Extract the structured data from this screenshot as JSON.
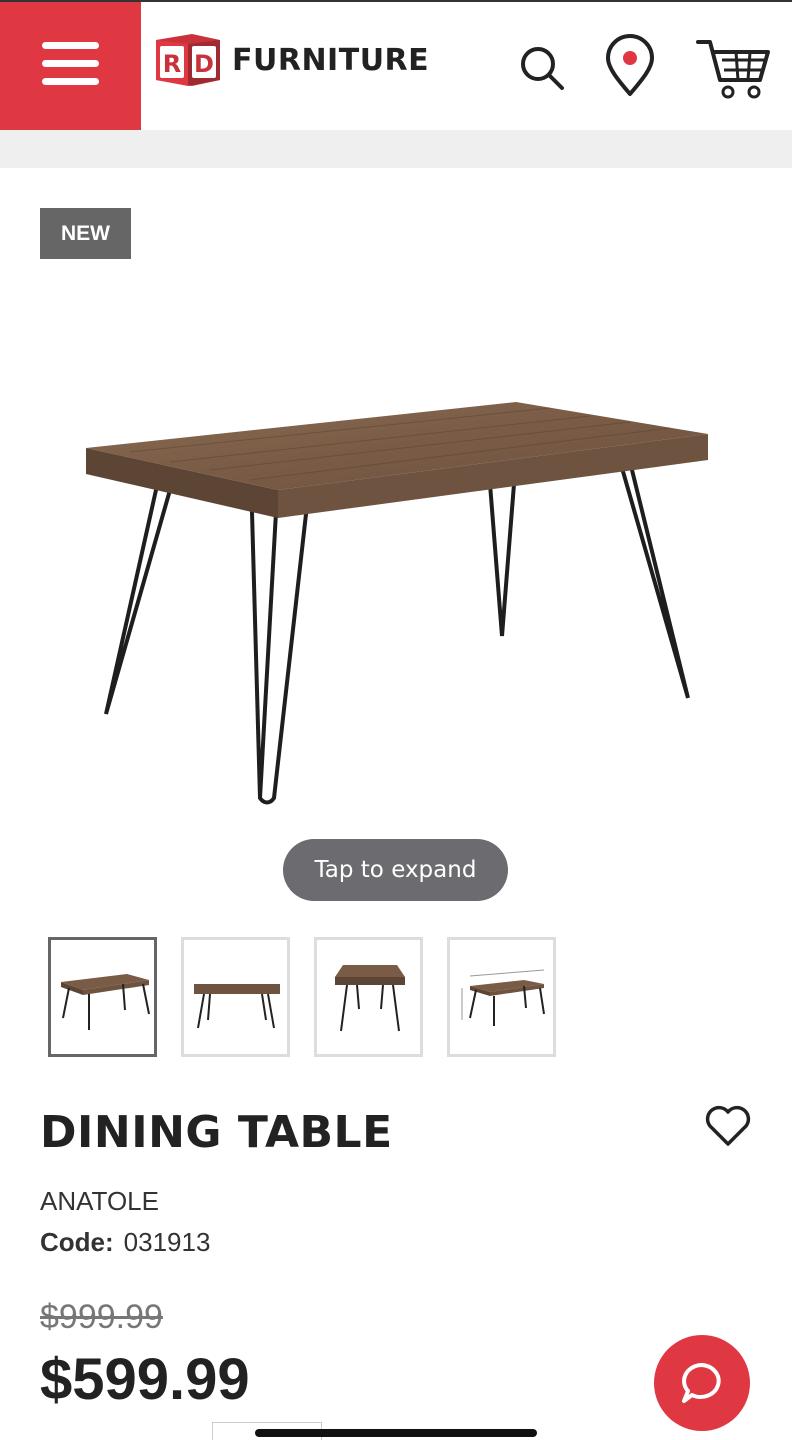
{
  "header": {
    "logo_letters": "RD",
    "logo_text": "FURNITURE",
    "icons": [
      "menu-icon",
      "search-icon",
      "location-pin-icon",
      "cart-icon"
    ]
  },
  "product": {
    "badge": "NEW",
    "expand_label": "Tap to expand",
    "thumbnails_count": 4,
    "selected_thumbnail": 1,
    "title": "DINING TABLE",
    "brand": "ANATOLE",
    "code_label": "Code:",
    "code_value": "031913",
    "original_price": "$999.99",
    "price": "$599.99"
  },
  "colors": {
    "accent": "#e03842",
    "badge_bg": "#666666",
    "pill_bg": "#6b6b70"
  }
}
